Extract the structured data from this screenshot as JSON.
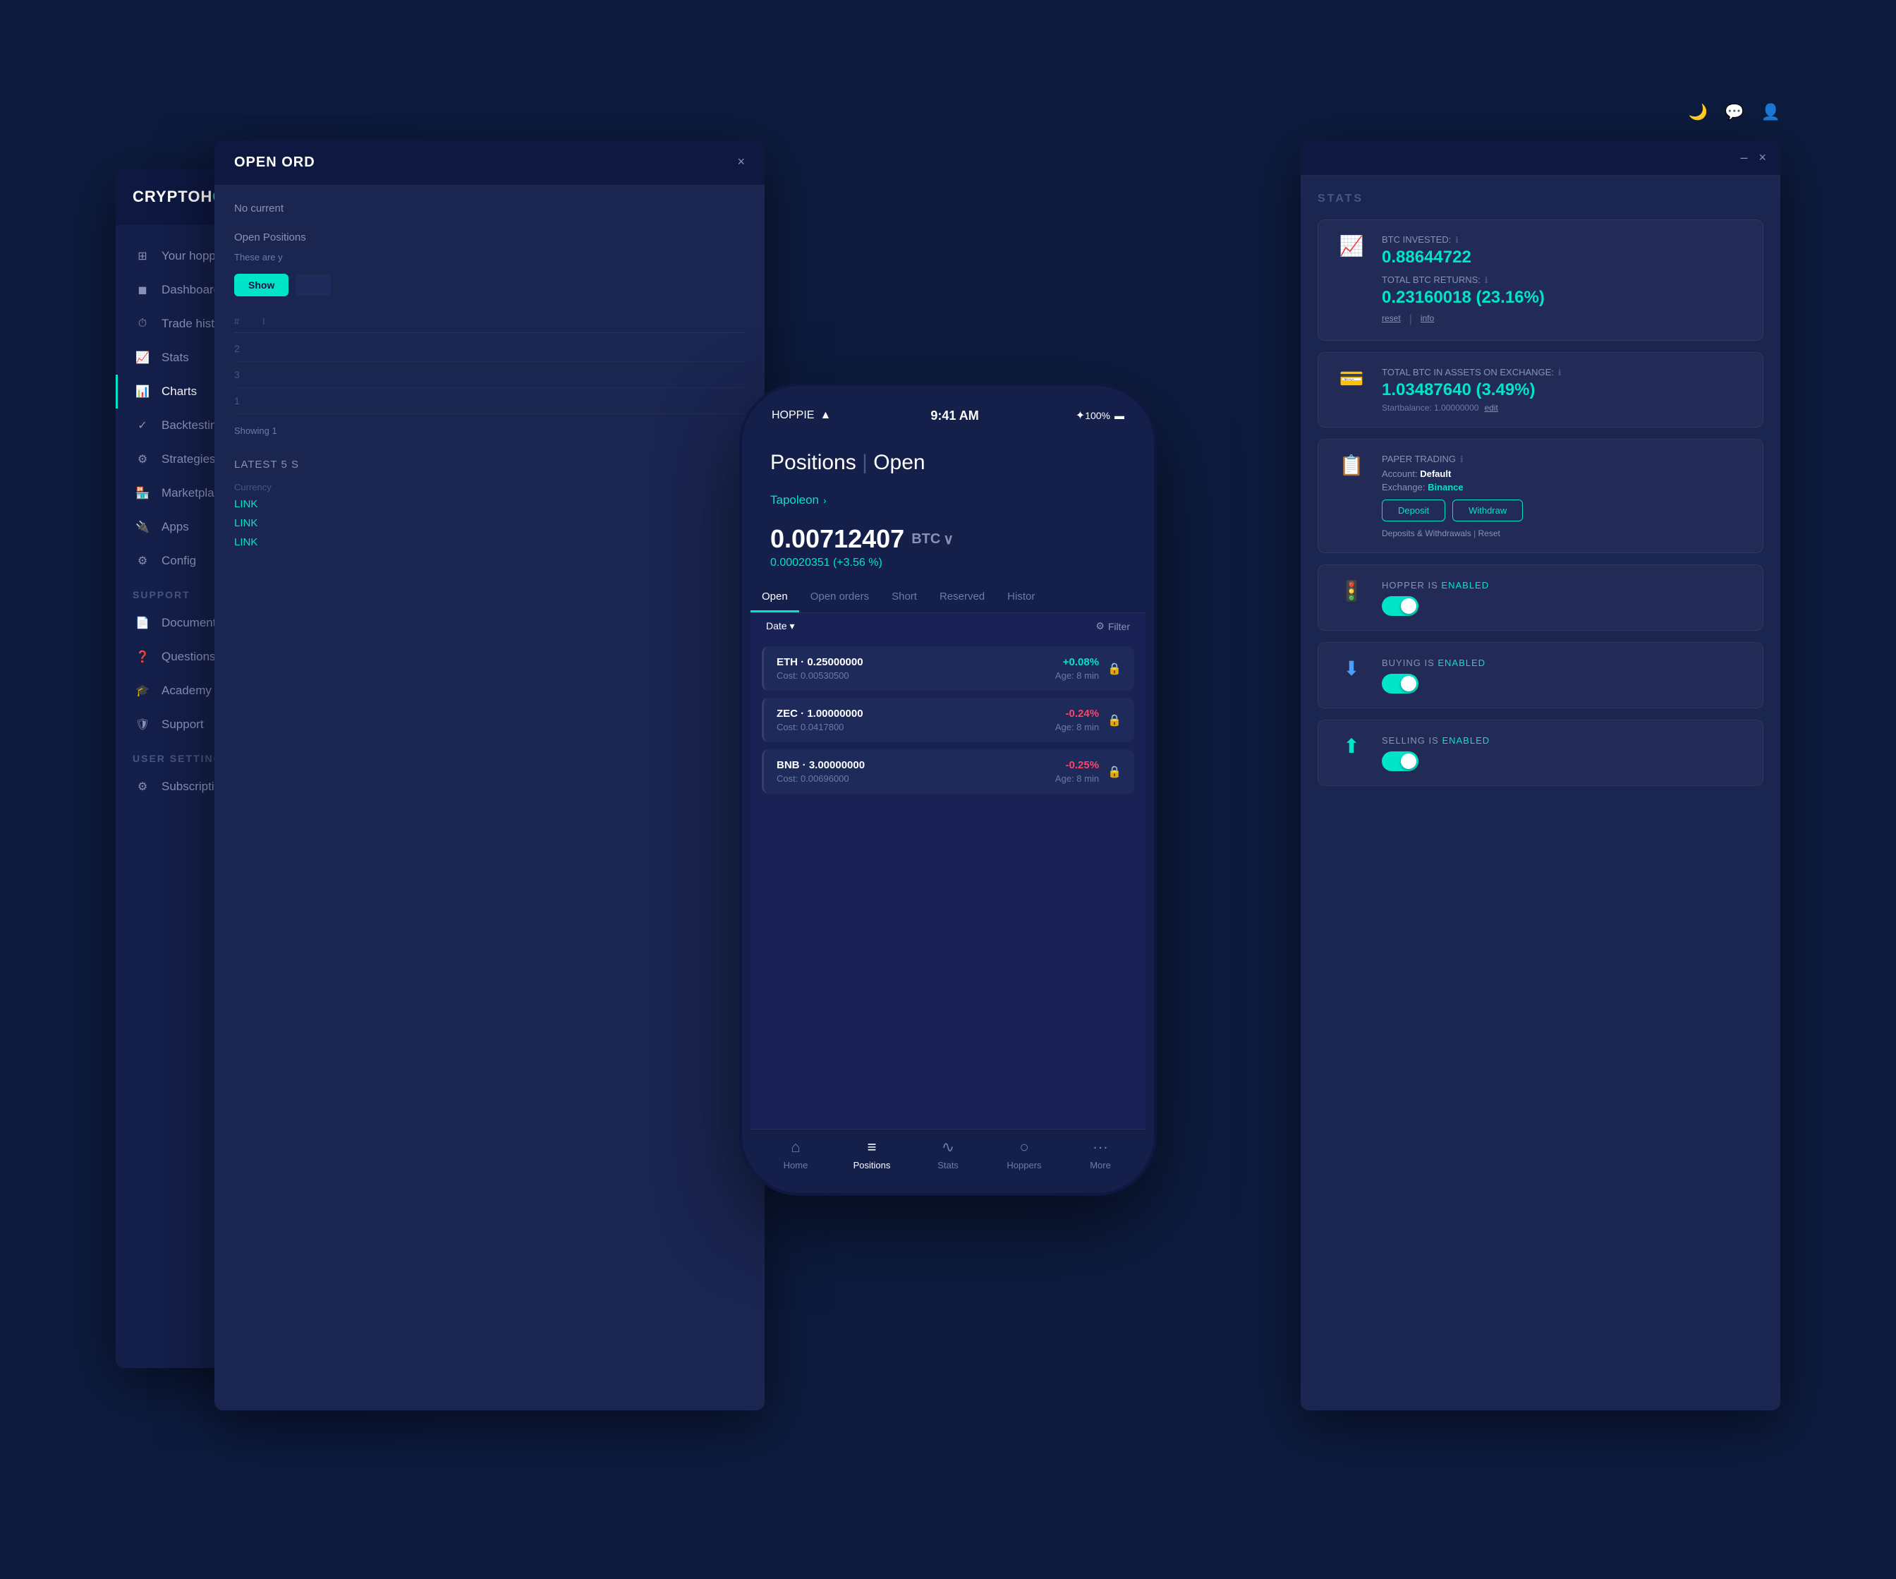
{
  "app": {
    "name": "CRYPTOHOPPER",
    "name_highlight": "O"
  },
  "global_nav": {
    "moon_icon": "🌙",
    "chat_icon": "💬",
    "user_icon": "👤",
    "minimize": "–",
    "close": "×"
  },
  "sidebar": {
    "items": [
      {
        "label": "Your hoppers",
        "icon": "⊞",
        "id": "your-hoppers"
      },
      {
        "label": "Dashboard",
        "icon": "⬛",
        "id": "dashboard"
      },
      {
        "label": "Trade history",
        "icon": "⏱",
        "id": "trade-history"
      },
      {
        "label": "Stats",
        "icon": "📈",
        "id": "stats"
      },
      {
        "label": "Charts",
        "icon": "📊",
        "id": "charts",
        "active": true
      },
      {
        "label": "Backtesting",
        "icon": "✓",
        "id": "backtesting"
      },
      {
        "label": "Strategies",
        "icon": "⚙",
        "id": "strategies"
      },
      {
        "label": "Marketplace",
        "icon": "🏪",
        "id": "marketplace"
      },
      {
        "label": "Apps",
        "icon": "🔌",
        "id": "apps"
      },
      {
        "label": "Config",
        "icon": "⚙",
        "id": "config",
        "has_arrow": true
      }
    ],
    "support_section": "SUPPORT",
    "support_items": [
      {
        "label": "Documentation",
        "icon": "📄"
      },
      {
        "label": "Questions",
        "icon": "❓"
      },
      {
        "label": "Academy",
        "icon": "🎓"
      },
      {
        "label": "Support",
        "icon": "🛡"
      }
    ],
    "user_settings_section": "USER SETTINGS",
    "user_items": [
      {
        "label": "Subscriptions",
        "icon": "⚙"
      }
    ]
  },
  "center_panel": {
    "title": "OPEN ORD",
    "no_current_text": "No current",
    "open_positions_label": "Open Positions",
    "positions_note": "These are y",
    "show_button": "Show",
    "table_rows": [
      {
        "num": "2"
      },
      {
        "num": "3"
      },
      {
        "num": "1"
      }
    ],
    "showing_text": "Showing 1",
    "latest_section": "LATEST 5 S",
    "currency_label": "Currency",
    "links": [
      "LINK",
      "LINK",
      "LINK"
    ]
  },
  "right_panel": {
    "stats_title": "STATS",
    "btc_invested_label": "BTC INVESTED:",
    "btc_invested_value": "0.88644722",
    "btc_returns_label": "TOTAL BTC RETURNS:",
    "btc_returns_value": "0.23160018 (23.16%)",
    "reset_link": "reset",
    "info_link": "info",
    "total_btc_label": "TOTAL BTC IN ASSETS ON EXCHANGE:",
    "total_btc_value": "1.03487640 (3.49%)",
    "startbalance": "Startbalance: 1.00000000",
    "edit_link": "edit",
    "paper_trading_label": "PAPER TRADING",
    "account_label": "Account:",
    "account_value": "Default",
    "exchange_label": "Exchange:",
    "exchange_value": "Binance",
    "deposit_btn": "Deposit",
    "withdraw_btn": "Withdraw",
    "deposits_link": "Deposits & Withdrawals",
    "reset_link2": "Reset",
    "hopper_enabled_label": "HOPPER IS",
    "hopper_enabled_status": "ENABLED",
    "buying_enabled_label": "BUYING IS",
    "buying_enabled_status": "ENABLED",
    "selling_enabled_label": "SELLING IS",
    "selling_enabled_status": "ENABLED"
  },
  "phone": {
    "carrier": "HOPPIE",
    "time": "9:41 AM",
    "battery": "100%",
    "page_title": "Positions",
    "page_subtitle": "Open",
    "hopper_name": "Tapoleon",
    "balance": "0.00712407",
    "currency": "BTC",
    "balance_change": "0.00020351 (+3.56 %)",
    "tabs": [
      {
        "label": "Open",
        "active": true
      },
      {
        "label": "Open orders"
      },
      {
        "label": "Short"
      },
      {
        "label": "Reserved"
      },
      {
        "label": "Histor"
      }
    ],
    "date_filter": "Date ▾",
    "filter_btn": "Filter",
    "positions": [
      {
        "name": "ETH · 0.25000000",
        "cost": "Cost: 0.00530500",
        "percent": "+0.08%",
        "positive": true,
        "age": "Age: 8 min"
      },
      {
        "name": "ZEC · 1.00000000",
        "cost": "Cost: 0.0417800",
        "percent": "-0.24%",
        "positive": false,
        "age": "Age: 8 min"
      },
      {
        "name": "BNB · 3.00000000",
        "cost": "Cost: 0.00696000",
        "percent": "-0.25%",
        "positive": false,
        "age": "Age: 8 min"
      }
    ],
    "bottom_nav": [
      {
        "label": "Home",
        "icon": "⌂",
        "active": false
      },
      {
        "label": "Positions",
        "icon": "≡",
        "active": true
      },
      {
        "label": "Stats",
        "icon": "∿",
        "active": false
      },
      {
        "label": "Hoppers",
        "icon": "○",
        "active": false
      },
      {
        "label": "More",
        "icon": "···",
        "active": false
      }
    ]
  }
}
